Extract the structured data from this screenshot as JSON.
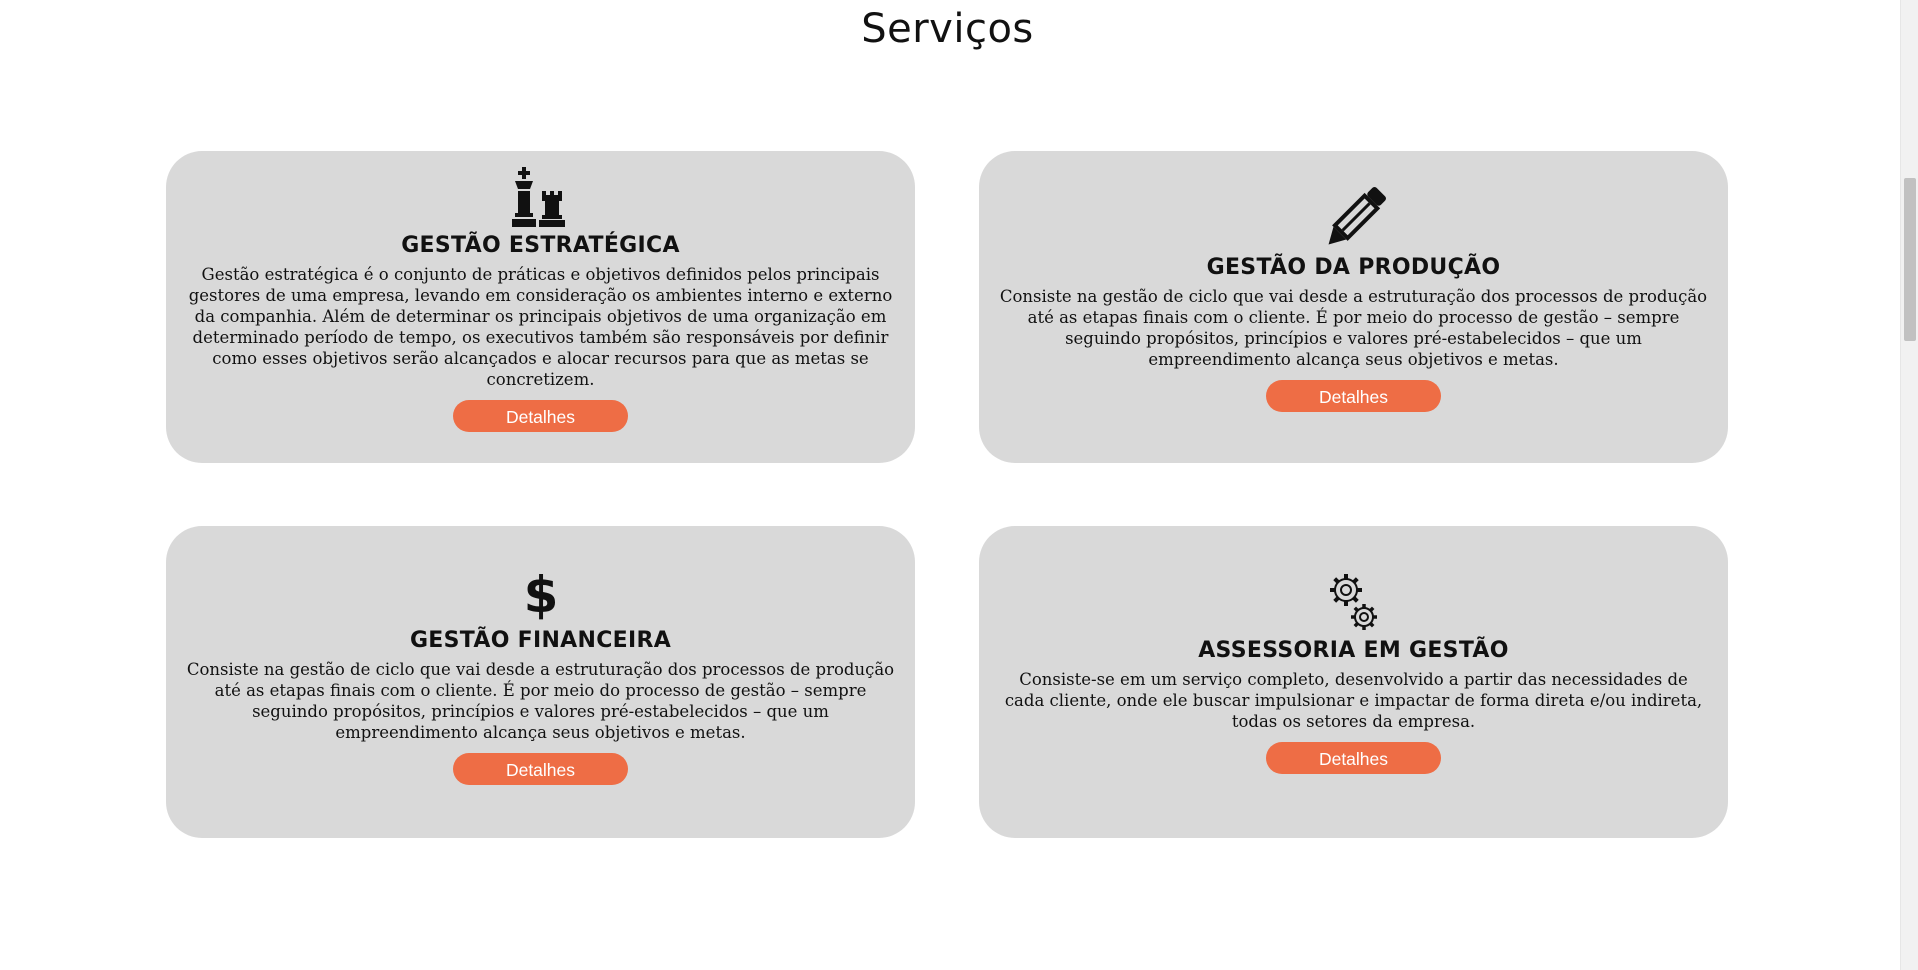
{
  "section": {
    "title": "Serviços"
  },
  "cards": [
    {
      "icon": "chess-icon",
      "title": "GESTÃO ESTRATÉGICA",
      "text": "Gestão estratégica é o conjunto de práticas e objetivos definidos pelos principais gestores de uma empresa, levando em consideração os ambientes interno e externo da companhia. Além de determinar os principais objetivos de uma organização em determinado período de tempo, os executivos também são responsáveis por definir como esses objetivos serão alcançados e alocar recursos para que as metas se concretizem.",
      "button": "Detalhes"
    },
    {
      "icon": "pencil-icon",
      "title": "GESTÃO DA PRODUÇÃO",
      "text": "Consiste na gestão de ciclo que vai desde a estruturação dos processos de produção até as etapas finais com o cliente. É por meio do processo de gestão – sempre seguindo propósitos, princípios e valores pré-estabelecidos – que um empreendimento alcança seus objetivos e metas.",
      "button": "Detalhes"
    },
    {
      "icon": "dollar-icon",
      "title": "GESTÃO FINANCEIRA",
      "text": "Consiste na gestão de ciclo que vai desde a estruturação dos processos de produção até as etapas finais com o cliente. É por meio do processo de gestão – sempre seguindo propósitos, princípios e valores pré-estabelecidos – que um empreendimento alcança seus objetivos e metas.",
      "button": "Detalhes"
    },
    {
      "icon": "gears-icon",
      "title": "ASSESSORIA EM GESTÃO",
      "text": "Consiste-se em um serviço completo, desenvolvido a partir das necessidades de cada cliente, onde ele buscar impulsionar e impactar de forma direta e/ou indireta, todas os setores da empresa.",
      "button": "Detalhes"
    }
  ],
  "colors": {
    "card_background": "#d9d9d9",
    "button_background": "#ee6d45",
    "button_text": "#ffffff"
  }
}
